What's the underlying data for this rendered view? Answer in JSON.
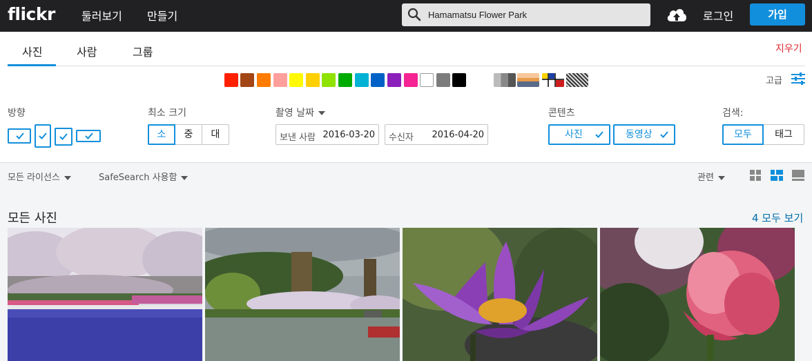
{
  "brand": {
    "logo": "flickr"
  },
  "topnav": {
    "explore": "둘러보기",
    "create": "만들기",
    "login": "로그인",
    "join": "가입"
  },
  "search": {
    "value": "Hamamatsu Flower Park"
  },
  "tabs": {
    "photos": "사진",
    "people": "사람",
    "groups": "그룹",
    "clear": "지우기"
  },
  "colors": {
    "swatches": [
      "#ff2000",
      "#a24615",
      "#ff7c00",
      "#ff9f9c",
      "#fffa00",
      "#ffcf00",
      "#90e200",
      "#00ab00",
      "#00b2d4",
      "#0062c6",
      "#8c20ba",
      "#f52394",
      "#ffffff",
      "#7c7c7c",
      "#000000"
    ],
    "patterns": [
      "black-and-white",
      "shallow-depth-of-field",
      "minimalist",
      "patterns"
    ],
    "accent": "#128fdc"
  },
  "advanced": {
    "label": "고급"
  },
  "filters": {
    "orientation_label": "방향",
    "min_size_label": "최소 크기",
    "sizes": [
      "소",
      "중",
      "대"
    ],
    "date_label": "촬영 날짜",
    "date_from_label": "보낸 사람",
    "date_from": "2016-03-20",
    "date_to_label": "수신자",
    "date_to": "2016-04-20",
    "content_label": "콘텐츠",
    "content_photos": "사진",
    "content_videos": "동영상",
    "search_label": "검색:",
    "search_all": "모두",
    "search_tags": "태그"
  },
  "toolbar": {
    "license": "모든 라이선스",
    "safesearch": "SafeSearch 사용함",
    "sort": "관련"
  },
  "results": {
    "title": "모든 사진",
    "view_all": "4 모두 보기"
  }
}
